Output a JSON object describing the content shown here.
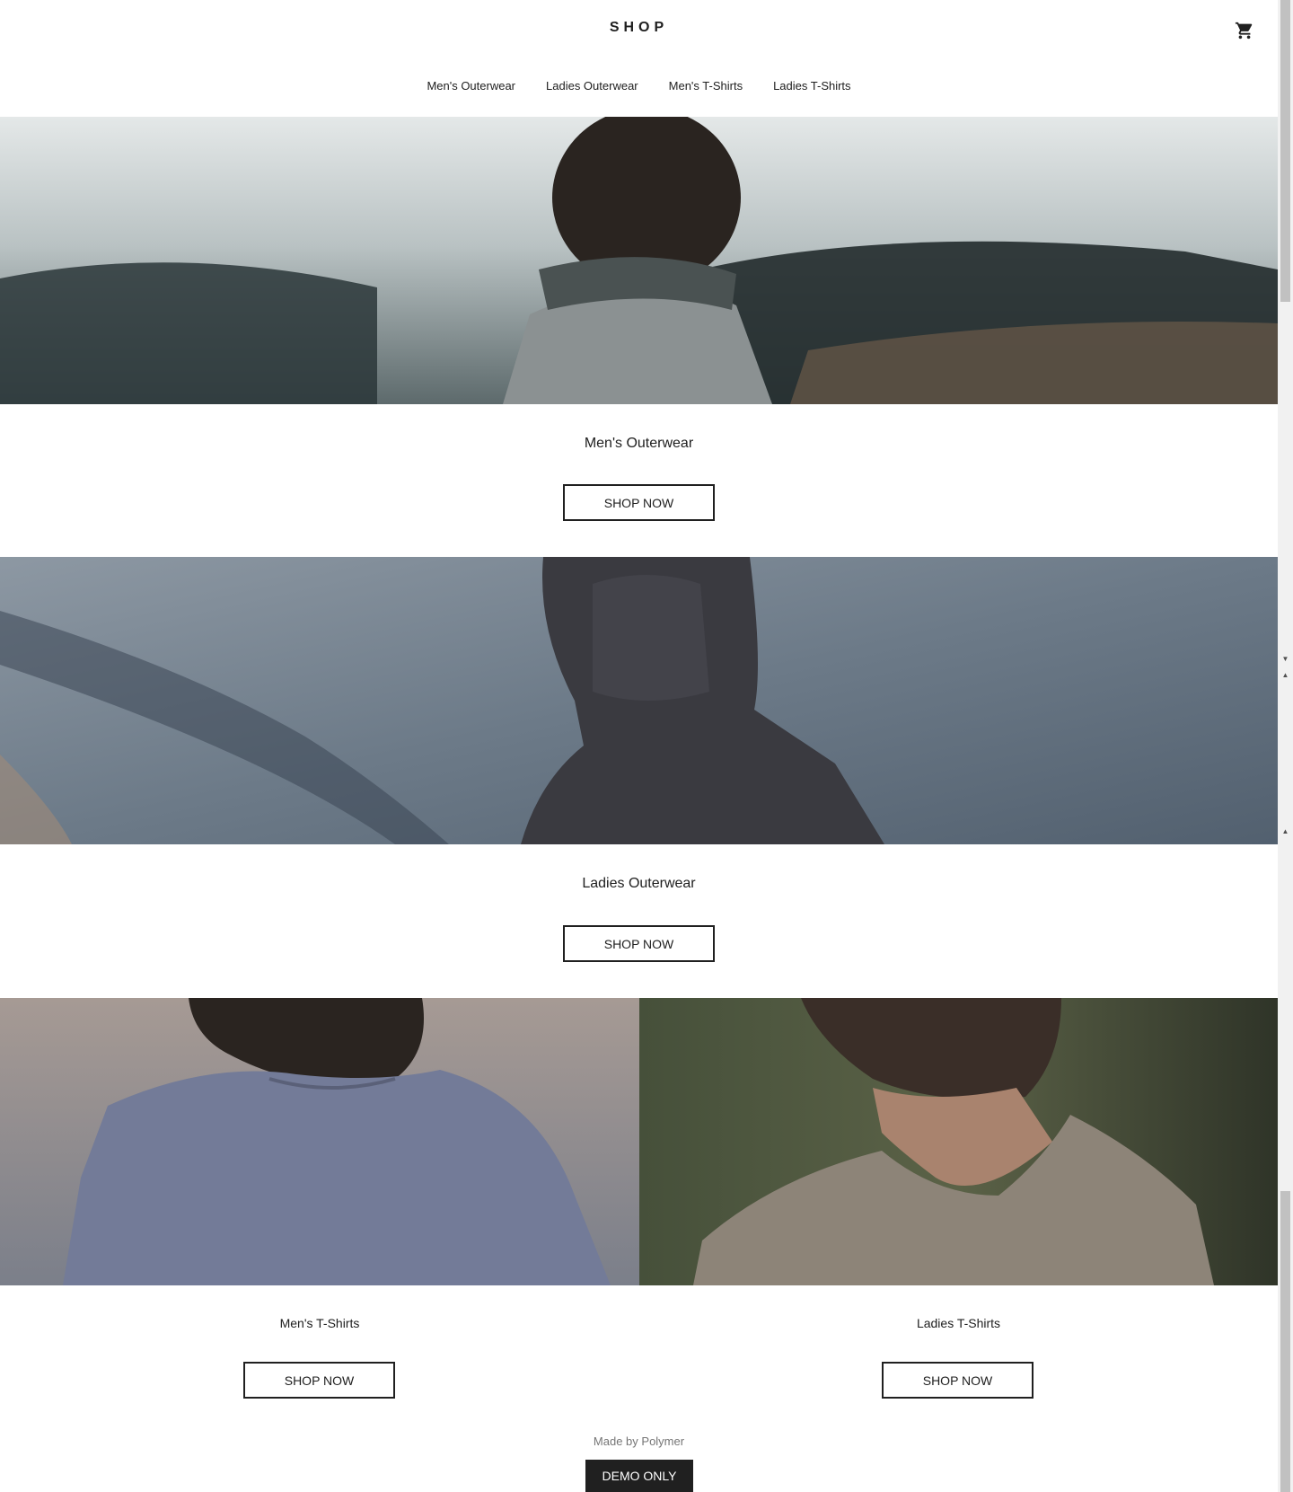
{
  "header": {
    "title": "SHOP",
    "cart_icon": "cart-icon"
  },
  "tabs": [
    {
      "label": "Men's Outerwear"
    },
    {
      "label": "Ladies Outerwear"
    },
    {
      "label": "Men's T-Shirts"
    },
    {
      "label": "Ladies T-Shirts"
    }
  ],
  "sections": [
    {
      "title": "Men's Outerwear",
      "button": "SHOP NOW"
    },
    {
      "title": "Ladies Outerwear",
      "button": "SHOP NOW"
    },
    {
      "title": "Men's T-Shirts",
      "button": "SHOP NOW"
    },
    {
      "title": "Ladies T-Shirts",
      "button": "SHOP NOW"
    }
  ],
  "footer": {
    "made_by": "Made by Polymer",
    "demo_badge": "DEMO ONLY"
  },
  "colors": {
    "text": "#202020",
    "muted": "#757575",
    "badge_bg": "#202020"
  }
}
